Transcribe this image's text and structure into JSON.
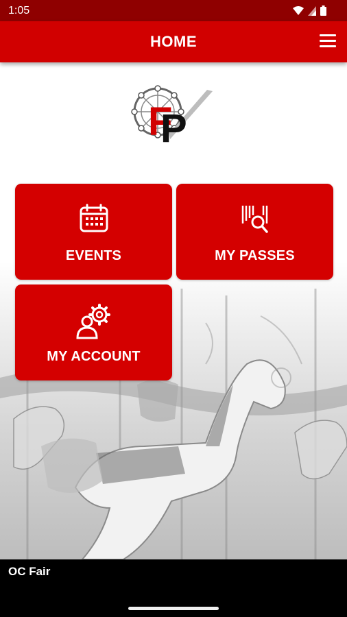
{
  "status_bar": {
    "time": "1:05"
  },
  "app_bar": {
    "title": "HOME",
    "menu_icon": "hamburger-menu-icon"
  },
  "logo": {
    "letters": "FP"
  },
  "tiles": [
    {
      "label": "EVENTS",
      "icon": "calendar-icon"
    },
    {
      "label": "MY PASSES",
      "icon": "barcode-search-icon"
    },
    {
      "label": "MY ACCOUNT",
      "icon": "user-gear-icon"
    }
  ],
  "footer": {
    "text": "OC Fair"
  },
  "colors": {
    "primary": "#d10000",
    "status_bar": "#8f0000",
    "tile": "#d40000"
  }
}
